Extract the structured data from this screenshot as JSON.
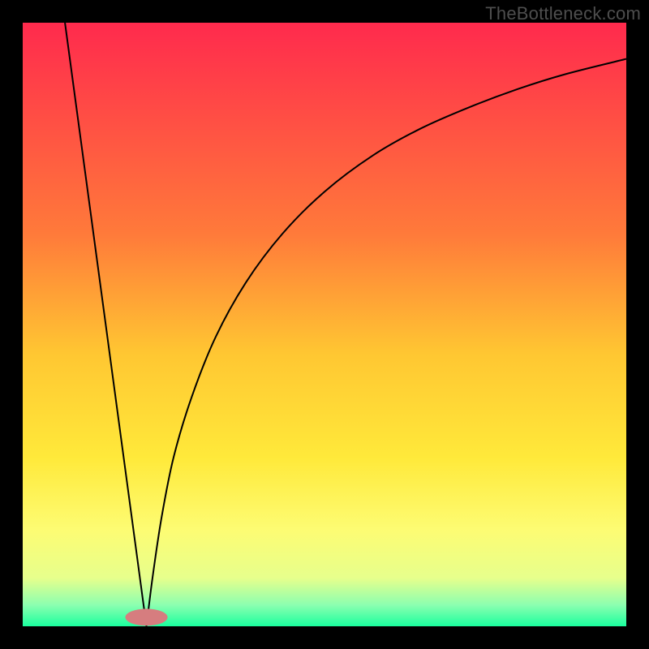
{
  "watermark": "TheBottleneck.com",
  "chart_data": {
    "type": "line",
    "title": "",
    "xlabel": "",
    "ylabel": "",
    "xlim": [
      0,
      100
    ],
    "ylim": [
      0,
      100
    ],
    "grid": false,
    "legend": false,
    "background": {
      "stops": [
        {
          "offset": 0.0,
          "color": "#ff2a4d"
        },
        {
          "offset": 0.35,
          "color": "#ff7a3a"
        },
        {
          "offset": 0.55,
          "color": "#ffc732"
        },
        {
          "offset": 0.72,
          "color": "#ffe93a"
        },
        {
          "offset": 0.84,
          "color": "#fdfc73"
        },
        {
          "offset": 0.92,
          "color": "#e7ff8c"
        },
        {
          "offset": 0.965,
          "color": "#8bffb0"
        },
        {
          "offset": 1.0,
          "color": "#1aff9e"
        }
      ]
    },
    "marker": {
      "x": 20.5,
      "y": 1.5,
      "rx": 3.5,
      "ry": 1.4,
      "color": "#d67d7f"
    },
    "series": [
      {
        "name": "left-branch",
        "x": [
          7,
          20.5
        ],
        "y": [
          100,
          0
        ]
      },
      {
        "name": "right-branch",
        "x": [
          20.5,
          21.5,
          23,
          25,
          28,
          32,
          37,
          43,
          50,
          58,
          66,
          74,
          82,
          90,
          100
        ],
        "y": [
          0,
          8,
          18,
          28,
          38,
          48,
          57,
          65,
          72,
          78,
          82.5,
          86,
          89,
          91.5,
          94
        ]
      }
    ]
  }
}
